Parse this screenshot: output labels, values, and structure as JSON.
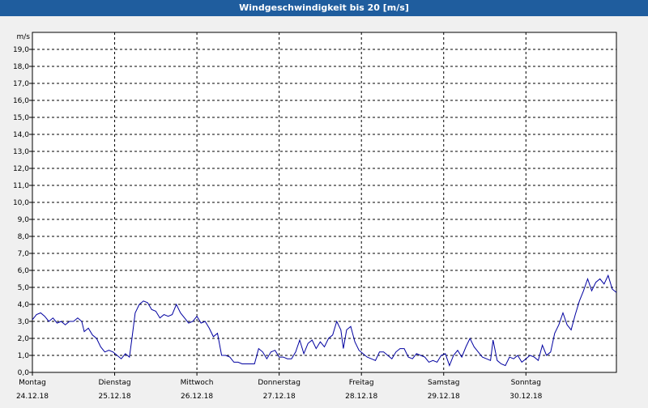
{
  "window": {
    "title": "Windgeschwindigkeit bis 20 [m/s]"
  },
  "chart_data": {
    "type": "line",
    "title": "Windgeschwindigkeit bis 20 [m/s]",
    "ylabel": "m/s",
    "ylim": [
      0,
      20
    ],
    "y_ticks": [
      "0,0",
      "1,0",
      "2,0",
      "3,0",
      "4,0",
      "5,0",
      "6,0",
      "7,0",
      "8,0",
      "9,0",
      "10,0",
      "11,0",
      "12,0",
      "13,0",
      "14,0",
      "15,0",
      "16,0",
      "17,0",
      "18,0",
      "19,0"
    ],
    "grid": true,
    "x_categories": [
      {
        "day": "Montag",
        "date": "24.12.18"
      },
      {
        "day": "Dienstag",
        "date": "25.12.18"
      },
      {
        "day": "Mittwoch",
        "date": "26.12.18"
      },
      {
        "day": "Donnerstag",
        "date": "27.12.18"
      },
      {
        "day": "Freitag",
        "date": "28.12.18"
      },
      {
        "day": "Samstag",
        "date": "29.12.18"
      },
      {
        "day": "Sonntag",
        "date": "30.12.18"
      }
    ],
    "xlim_days": [
      0,
      7.1
    ],
    "series": [
      {
        "color": "#0000a0",
        "points": [
          [
            0.0,
            3.1
          ],
          [
            0.05,
            3.4
          ],
          [
            0.1,
            3.5
          ],
          [
            0.15,
            3.3
          ],
          [
            0.2,
            3.0
          ],
          [
            0.25,
            3.2
          ],
          [
            0.3,
            2.9
          ],
          [
            0.35,
            3.0
          ],
          [
            0.4,
            2.8
          ],
          [
            0.45,
            3.0
          ],
          [
            0.5,
            3.0
          ],
          [
            0.55,
            3.2
          ],
          [
            0.6,
            3.0
          ],
          [
            0.63,
            2.4
          ],
          [
            0.68,
            2.6
          ],
          [
            0.73,
            2.2
          ],
          [
            0.78,
            2.0
          ],
          [
            0.83,
            1.5
          ],
          [
            0.88,
            1.2
          ],
          [
            0.93,
            1.3
          ],
          [
            0.98,
            1.2
          ],
          [
            1.03,
            1.0
          ],
          [
            1.08,
            0.8
          ],
          [
            1.13,
            1.1
          ],
          [
            1.18,
            0.9
          ],
          [
            1.21,
            2.0
          ],
          [
            1.25,
            3.5
          ],
          [
            1.3,
            4.0
          ],
          [
            1.35,
            4.2
          ],
          [
            1.4,
            4.1
          ],
          [
            1.45,
            3.7
          ],
          [
            1.5,
            3.6
          ],
          [
            1.55,
            3.2
          ],
          [
            1.6,
            3.4
          ],
          [
            1.65,
            3.3
          ],
          [
            1.7,
            3.4
          ],
          [
            1.75,
            4.0
          ],
          [
            1.8,
            3.5
          ],
          [
            1.85,
            3.2
          ],
          [
            1.9,
            2.9
          ],
          [
            1.95,
            3.0
          ],
          [
            2.0,
            3.3
          ],
          [
            2.05,
            2.9
          ],
          [
            2.1,
            3.0
          ],
          [
            2.15,
            2.6
          ],
          [
            2.2,
            2.1
          ],
          [
            2.25,
            2.3
          ],
          [
            2.3,
            1.0
          ],
          [
            2.35,
            1.0
          ],
          [
            2.4,
            0.9
          ],
          [
            2.45,
            0.6
          ],
          [
            2.5,
            0.6
          ],
          [
            2.55,
            0.5
          ],
          [
            2.6,
            0.5
          ],
          [
            2.65,
            0.5
          ],
          [
            2.7,
            0.5
          ],
          [
            2.75,
            1.4
          ],
          [
            2.8,
            1.2
          ],
          [
            2.85,
            0.8
          ],
          [
            2.9,
            1.2
          ],
          [
            2.95,
            1.3
          ],
          [
            3.0,
            0.9
          ],
          [
            3.05,
            0.9
          ],
          [
            3.1,
            0.8
          ],
          [
            3.15,
            0.8
          ],
          [
            3.2,
            1.2
          ],
          [
            3.25,
            1.9
          ],
          [
            3.3,
            1.1
          ],
          [
            3.35,
            1.7
          ],
          [
            3.4,
            1.9
          ],
          [
            3.45,
            1.4
          ],
          [
            3.5,
            1.8
          ],
          [
            3.55,
            1.5
          ],
          [
            3.6,
            2.0
          ],
          [
            3.65,
            2.2
          ],
          [
            3.7,
            3.0
          ],
          [
            3.75,
            2.5
          ],
          [
            3.78,
            1.4
          ],
          [
            3.82,
            2.5
          ],
          [
            3.87,
            2.7
          ],
          [
            3.92,
            1.8
          ],
          [
            3.97,
            1.3
          ],
          [
            4.02,
            1.1
          ],
          [
            4.07,
            0.9
          ],
          [
            4.12,
            0.8
          ],
          [
            4.17,
            0.7
          ],
          [
            4.22,
            1.2
          ],
          [
            4.27,
            1.2
          ],
          [
            4.32,
            1.0
          ],
          [
            4.37,
            0.8
          ],
          [
            4.42,
            1.2
          ],
          [
            4.47,
            1.4
          ],
          [
            4.52,
            1.4
          ],
          [
            4.57,
            0.9
          ],
          [
            4.62,
            0.8
          ],
          [
            4.67,
            1.1
          ],
          [
            4.72,
            1.0
          ],
          [
            4.77,
            0.9
          ],
          [
            4.82,
            0.6
          ],
          [
            4.87,
            0.7
          ],
          [
            4.92,
            0.6
          ],
          [
            4.97,
            1.0
          ],
          [
            5.02,
            1.1
          ],
          [
            5.07,
            0.4
          ],
          [
            5.12,
            1.0
          ],
          [
            5.17,
            1.3
          ],
          [
            5.22,
            0.9
          ],
          [
            5.27,
            1.5
          ],
          [
            5.32,
            2.0
          ],
          [
            5.37,
            1.5
          ],
          [
            5.42,
            1.2
          ],
          [
            5.47,
            0.9
          ],
          [
            5.52,
            0.8
          ],
          [
            5.57,
            0.7
          ],
          [
            5.6,
            1.9
          ],
          [
            5.65,
            0.7
          ],
          [
            5.7,
            0.5
          ],
          [
            5.75,
            0.4
          ],
          [
            5.8,
            0.9
          ],
          [
            5.85,
            0.8
          ],
          [
            5.9,
            1.0
          ],
          [
            5.95,
            0.6
          ],
          [
            6.0,
            0.8
          ],
          [
            6.05,
            1.0
          ],
          [
            6.1,
            0.9
          ],
          [
            6.15,
            0.7
          ],
          [
            6.2,
            1.6
          ],
          [
            6.25,
            1.0
          ],
          [
            6.3,
            1.2
          ],
          [
            6.35,
            2.3
          ],
          [
            6.4,
            2.8
          ],
          [
            6.45,
            3.5
          ],
          [
            6.5,
            2.8
          ],
          [
            6.55,
            2.5
          ],
          [
            6.6,
            3.4
          ],
          [
            6.65,
            4.2
          ],
          [
            6.7,
            4.8
          ],
          [
            6.75,
            5.5
          ],
          [
            6.8,
            4.8
          ],
          [
            6.85,
            5.3
          ],
          [
            6.9,
            5.5
          ],
          [
            6.95,
            5.2
          ],
          [
            7.0,
            5.7
          ],
          [
            7.05,
            4.9
          ],
          [
            7.1,
            4.7
          ]
        ]
      }
    ]
  }
}
